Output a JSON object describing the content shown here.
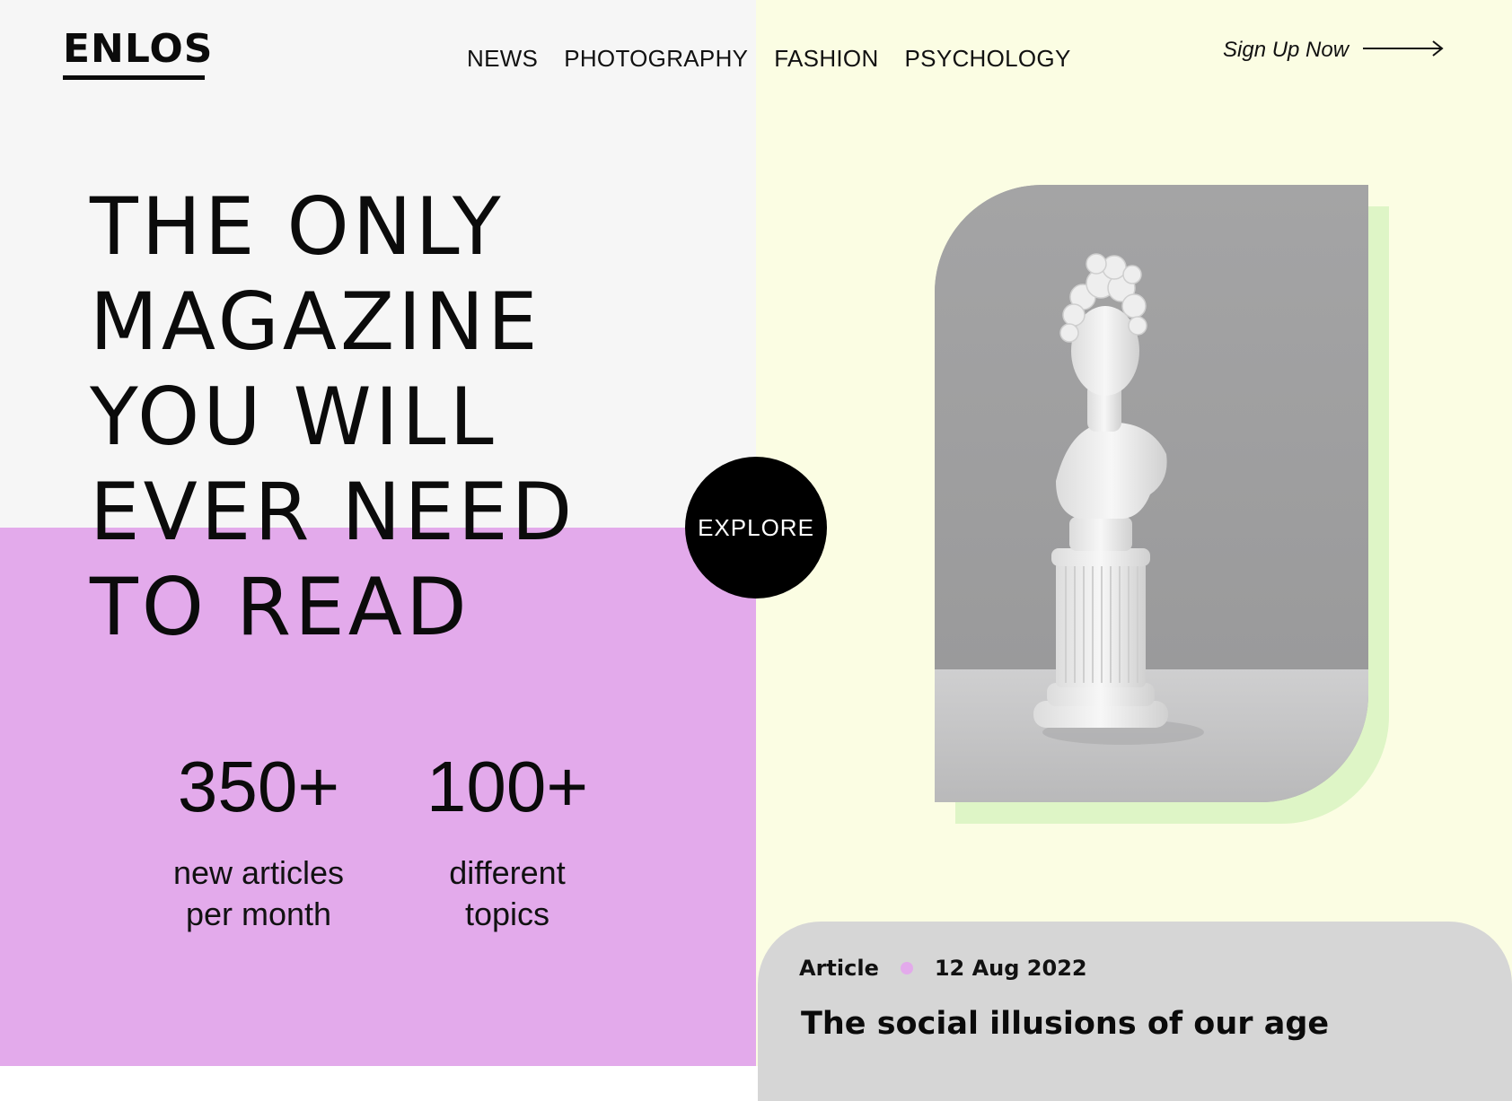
{
  "brand": {
    "logo": "ENLOS"
  },
  "nav": {
    "items": [
      {
        "label": "NEWS"
      },
      {
        "label": "PHOTOGRAPHY"
      },
      {
        "label": "FASHION"
      },
      {
        "label": "PSYCHOLOGY"
      }
    ]
  },
  "header": {
    "signup_label": "Sign Up Now",
    "signup_icon": "arrow-right-icon"
  },
  "hero": {
    "title_lines": [
      "THE ONLY",
      "MAGAZINE",
      "YOU WILL",
      "EVER NEED",
      "TO READ"
    ],
    "cta_label": "EXPLORE",
    "image_alt": "statue-bust-photo"
  },
  "stats": [
    {
      "value": "350+",
      "label_lines": [
        "new articles",
        "per month"
      ]
    },
    {
      "value": "100+",
      "label_lines": [
        "different",
        "topics"
      ]
    }
  ],
  "article": {
    "type": "Article",
    "date": "12 Aug 2022",
    "title": "The social illusions of our age"
  },
  "colors": {
    "left_top_bg": "#f6f6f6",
    "left_bottom_bg": "#e3aaeb",
    "right_bg": "#fbfde3",
    "image_shadow": "#def5c6",
    "card_bg": "#d6d6d6",
    "accent_dot": "#e3aaeb",
    "cta_bg": "#000000"
  }
}
